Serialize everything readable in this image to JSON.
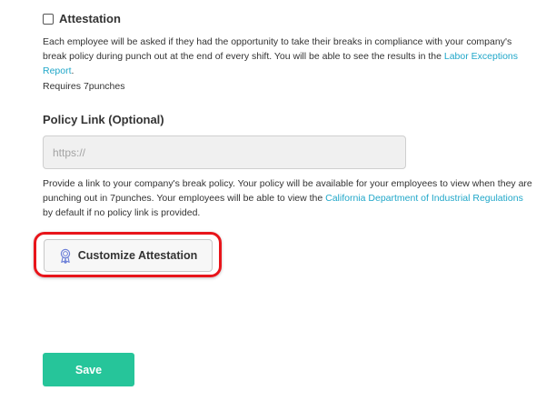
{
  "attestation": {
    "checkbox_checked": false,
    "label": "Attestation",
    "description_prefix": "Each employee will be asked if they had the opportunity to take their breaks in compliance with your company's break policy during punch out at the end of every shift. You will be able to see the results in the ",
    "description_link": "Labor Exceptions Report",
    "description_suffix": ".",
    "requires": "Requires 7punches"
  },
  "policy_link": {
    "label": "Policy Link (Optional)",
    "placeholder": "https://",
    "value": "",
    "help_prefix": "Provide a link to your company's break policy. Your policy will be available for your employees to view when they are punching out in 7punches. Your employees will be able to view the ",
    "help_link": "California Department of Industrial Regulations",
    "help_suffix": " by default if no policy link is provided."
  },
  "customize_button": {
    "label": "Customize Attestation",
    "icon": "ribbon-badge-icon",
    "highlight_color": "#e8151b"
  },
  "save_button": {
    "label": "Save",
    "color": "#26c59a"
  },
  "colors": {
    "link": "#20a7c9",
    "text": "#333333"
  }
}
